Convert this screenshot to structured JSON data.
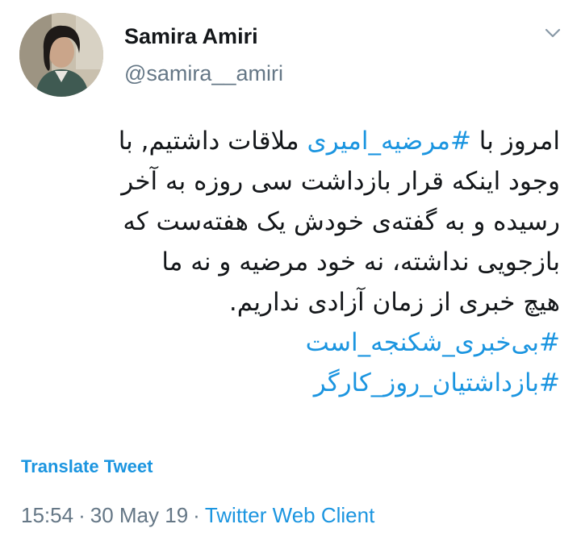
{
  "user": {
    "display_name": "Samira Amiri",
    "handle": "@samira__amiri",
    "avatar_icon": "profile-photo"
  },
  "menu": {
    "caret_icon": "chevron-down-icon"
  },
  "tweet": {
    "line1": {
      "before": "امروز با ",
      "hashtag": "#مرضیه_امیری",
      "after": " ملاقات داشتیم, با"
    },
    "line2": "وجود اینکه قرار بازداشت سی روزه به آخر",
    "line3": "رسیده و به گفته‌ی خودش یک هفته‌ست که",
    "line4": "بازجویی نداشته، نه خود مرضیه و نه ما",
    "line5": "هیچ خبری از زمان آزادی نداریم.",
    "hashtag2": "#بی‌خبری_شکنجه_است",
    "hashtag3": "#بازداشتیان_روز_کارگر"
  },
  "translate_label": "Translate Tweet",
  "meta": {
    "time": "15:54",
    "separator1": "·",
    "date": "30 May 19",
    "separator2": "·",
    "client": "Twitter Web Client"
  },
  "colors": {
    "link": "#1b95e0",
    "text": "#14171a",
    "secondary": "#657786"
  }
}
